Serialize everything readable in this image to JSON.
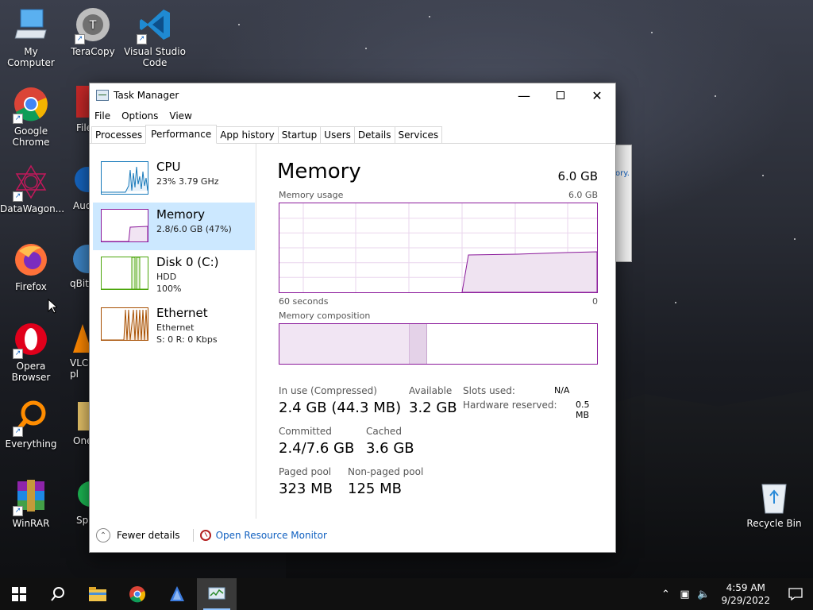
{
  "desktop": {
    "icons": [
      {
        "label": "My Computer"
      },
      {
        "label": "TeraCopy"
      },
      {
        "label": "Visual Studio Code"
      },
      {
        "label": "Google Chrome"
      },
      {
        "label": "File"
      },
      {
        "label": "DataWagon..."
      },
      {
        "label": "Audi"
      },
      {
        "label": "Firefox"
      },
      {
        "label": "qBitt"
      },
      {
        "label": "Opera Browser"
      },
      {
        "label": "VLC pl"
      },
      {
        "label": "Everything"
      },
      {
        "label": "One"
      },
      {
        "label": "WinRAR"
      },
      {
        "label": "Sp"
      },
      {
        "label": "Recycle Bin"
      }
    ],
    "behind_window_text": "ory."
  },
  "window": {
    "title": "Task Manager",
    "menu": [
      "File",
      "Options",
      "View"
    ],
    "tabs": [
      "Processes",
      "Performance",
      "App history",
      "Startup",
      "Users",
      "Details",
      "Services"
    ],
    "active_tab": "Performance"
  },
  "sidebar": {
    "items": [
      {
        "name": "CPU",
        "sub1": "23%  3.79 GHz",
        "sub2": "",
        "color": "#1779ba"
      },
      {
        "name": "Memory",
        "sub1": "2.8/6.0 GB (47%)",
        "sub2": "",
        "color": "#8b1a9b"
      },
      {
        "name": "Disk 0 (C:)",
        "sub1": "HDD",
        "sub2": "100%",
        "color": "#4da60c"
      },
      {
        "name": "Ethernet",
        "sub1": "Ethernet",
        "sub2": "S: 0  R: 0 Kbps",
        "color": "#a74f01"
      }
    ],
    "selected": "Memory"
  },
  "memory": {
    "title": "Memory",
    "total": "6.0 GB",
    "usage_label": "Memory usage",
    "usage_max": "6.0 GB",
    "axis_left": "60 seconds",
    "axis_right": "0",
    "composition_label": "Memory composition",
    "usage_fraction": 0.47,
    "stats": {
      "in_use_label": "In use (Compressed)",
      "in_use_value": "2.4 GB (44.3 MB)",
      "available_label": "Available",
      "available_value": "3.2 GB",
      "committed_label": "Committed",
      "committed_value": "2.4/7.6 GB",
      "cached_label": "Cached",
      "cached_value": "3.6 GB",
      "paged_label": "Paged pool",
      "paged_value": "323 MB",
      "nonpaged_label": "Non-paged pool",
      "nonpaged_value": "125 MB",
      "slots_label": "Slots used:",
      "slots_value": "N/A",
      "hw_reserved_label": "Hardware reserved:",
      "hw_reserved_value": "0.5 MB"
    }
  },
  "footer": {
    "fewer_details": "Fewer details",
    "open_resource_monitor": "Open Resource Monitor"
  },
  "taskbar": {
    "time": "4:59 AM",
    "date": "9/29/2022",
    "pinned": [
      "start-icon",
      "search-icon",
      "file-explorer-icon",
      "chrome-icon",
      "app-icon",
      "task-manager-icon"
    ]
  },
  "colors": {
    "memory_accent": "#8b1a9b",
    "selected_bg": "#cce8ff",
    "link": "#1060c0"
  }
}
